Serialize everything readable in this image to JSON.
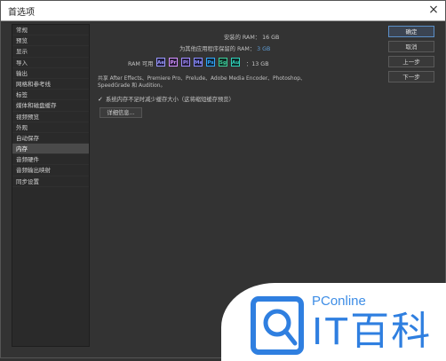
{
  "window": {
    "title": "首选项",
    "close_glyph": "×"
  },
  "sidebar": {
    "items": [
      {
        "label": "常规"
      },
      {
        "label": "预览"
      },
      {
        "label": "显示"
      },
      {
        "label": "导入"
      },
      {
        "label": "输出"
      },
      {
        "label": "网格和参考线"
      },
      {
        "label": "标签"
      },
      {
        "label": "媒体和磁盘缓存"
      },
      {
        "label": "视频预览"
      },
      {
        "label": "外观"
      },
      {
        "label": "自动保存"
      },
      {
        "label": "内存"
      },
      {
        "label": "音频硬件"
      },
      {
        "label": "音频输出映射"
      },
      {
        "label": "同步设置"
      }
    ],
    "selected": "内存"
  },
  "memory": {
    "installed_label": "安装的 RAM：",
    "installed_value": "16 GB",
    "reserved_label": "为其他应用程序保留的 RAM：",
    "reserved_value": "3 GB",
    "available_label": "RAM 可用",
    "available_value": "：13 GB",
    "app_icons": [
      {
        "abbr": "Ae",
        "color": "#9999ff",
        "bg": "#1f1a3a",
        "name": "after-effects-icon"
      },
      {
        "abbr": "Pr",
        "color": "#d291ff",
        "bg": "#2a1c38",
        "name": "premiere-icon"
      },
      {
        "abbr": "Pl",
        "color": "#a08cff",
        "bg": "#241c38",
        "name": "prelude-icon"
      },
      {
        "abbr": "Me",
        "color": "#8a8cff",
        "bg": "#1c1c38",
        "name": "media-encoder-icon"
      },
      {
        "abbr": "Ps",
        "color": "#31a8ff",
        "bg": "#102638",
        "name": "photoshop-icon"
      },
      {
        "abbr": "Sg",
        "color": "#3fcf9c",
        "bg": "#0f2c24",
        "name": "speedgrade-icon"
      },
      {
        "abbr": "Au",
        "color": "#2fd0b8",
        "bg": "#0f2a28",
        "name": "audition-icon"
      }
    ],
    "shared_text": "共享 After Effects、Premiere Pro、Prelude、Adobe Media Encoder、Photoshop、SpeedGrade 和 Audition。",
    "checkbox_glyph": "✓",
    "checkbox_label": "系统内存不足时减少缓存大小（这将缩短缓存预览）",
    "details_button": "详细信息..."
  },
  "buttons": {
    "ok": "确定",
    "cancel": "取消",
    "prev": "上一步",
    "next": "下一步"
  },
  "watermark": {
    "line1": "PConline",
    "line2": "IT百科"
  },
  "colors": {
    "accent": "#5f9ed8",
    "panel_bg": "#333333",
    "selected_bg": "#4a4a4a",
    "watermark_blue": "#2f7fe0"
  }
}
